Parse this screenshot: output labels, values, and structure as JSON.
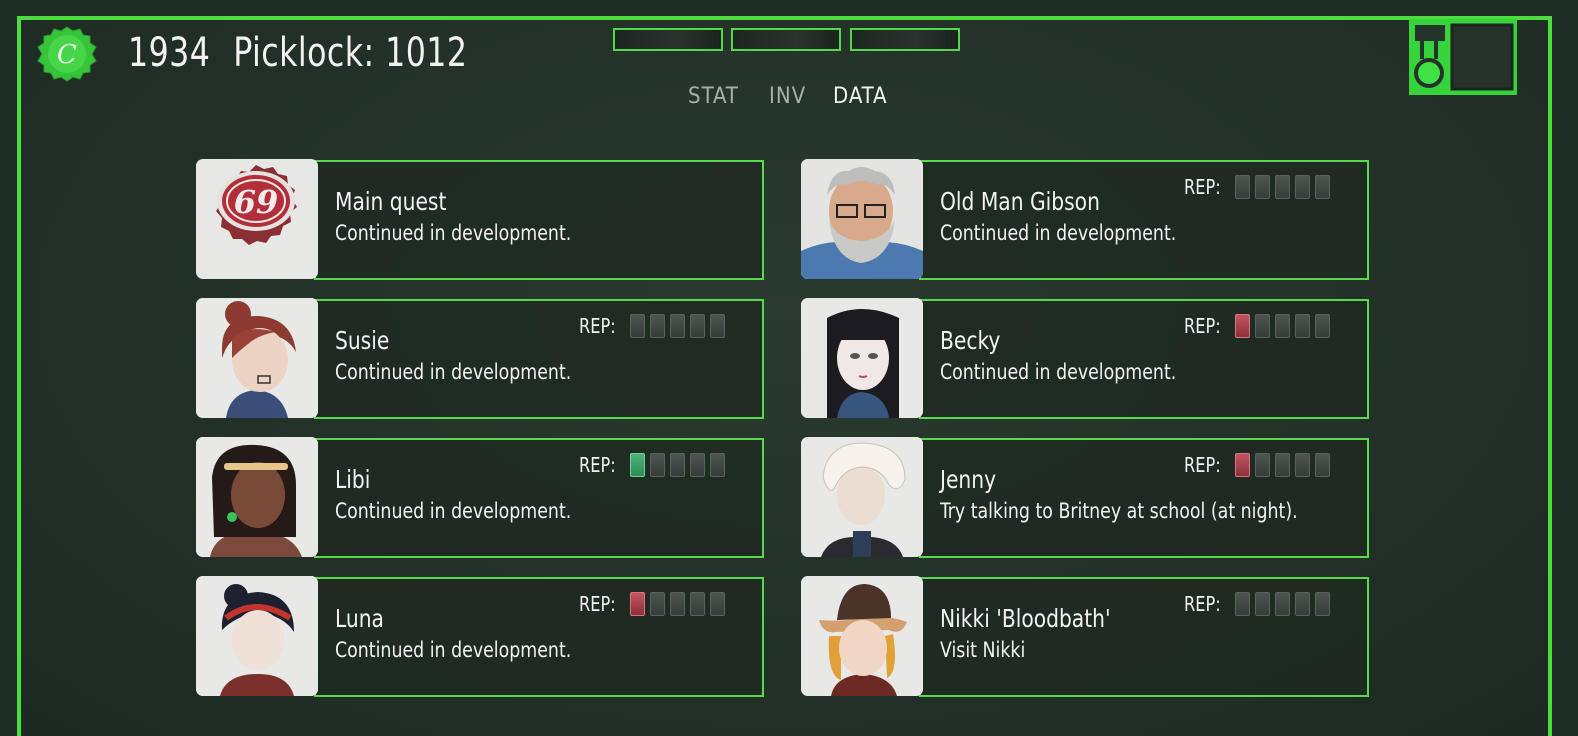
{
  "header": {
    "year": "1934",
    "picklock_label": "Picklock: 1012",
    "coin_letter": "C",
    "colors": {
      "accent": "#4ddd3e"
    }
  },
  "tabs": [
    {
      "label": "STAT",
      "active": false
    },
    {
      "label": "INV",
      "active": false
    },
    {
      "label": "DATA",
      "active": true
    }
  ],
  "cards": [
    {
      "name": "Main quest",
      "desc": "Continued in development.",
      "rep": null,
      "badge": "69"
    },
    {
      "name": "Old Man Gibson",
      "desc": "Continued in development.",
      "rep": {
        "label": "REP:",
        "filled": 0,
        "color": "none"
      }
    },
    {
      "name": "Susie",
      "desc": "Continued in development.",
      "rep": {
        "label": "REP:",
        "filled": 0,
        "color": "none"
      }
    },
    {
      "name": "Becky",
      "desc": "Continued in development.",
      "rep": {
        "label": "REP:",
        "filled": 1,
        "color": "red"
      }
    },
    {
      "name": "Libi",
      "desc": "Continued in development.",
      "rep": {
        "label": "REP:",
        "filled": 1,
        "color": "green"
      }
    },
    {
      "name": "Jenny",
      "desc": "Try talking to Britney at school (at night).",
      "rep": {
        "label": "REP:",
        "filled": 1,
        "color": "red"
      }
    },
    {
      "name": "Luna",
      "desc": "Continued in development.",
      "rep": {
        "label": "REP:",
        "filled": 1,
        "color": "red"
      }
    },
    {
      "name": "Nikki 'Bloodbath'",
      "desc": "Visit Nikki",
      "rep": {
        "label": "REP:",
        "filled": 0,
        "color": "none"
      }
    }
  ]
}
